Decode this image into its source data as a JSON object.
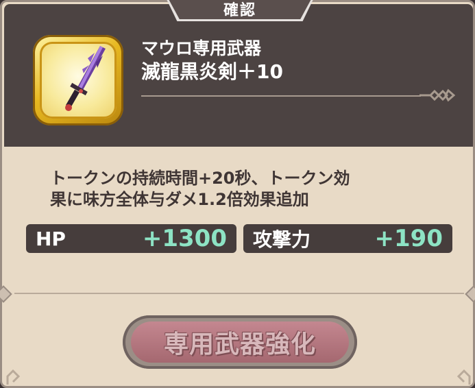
{
  "dialog": {
    "title": "確認"
  },
  "item": {
    "icon": "purple-crystal-sword-icon",
    "name_line1": "マウロ専用武器",
    "name_line2": "滅龍黒炎剣＋10"
  },
  "description": {
    "line1": "トークンの持続時間+20秒、トークン効",
    "line2": "果に味方全体与ダメ1.2倍効果追加"
  },
  "stats": [
    {
      "label": "HP",
      "value": "+1300"
    },
    {
      "label": "攻撃力",
      "value": "+190"
    }
  ],
  "button": {
    "label": "専用武器強化",
    "state": "disabled"
  },
  "colors": {
    "panel_dark": "#4c4342",
    "panel_light": "#e8dac6",
    "stat_value": "#8de3c4",
    "button": "#b57880"
  }
}
